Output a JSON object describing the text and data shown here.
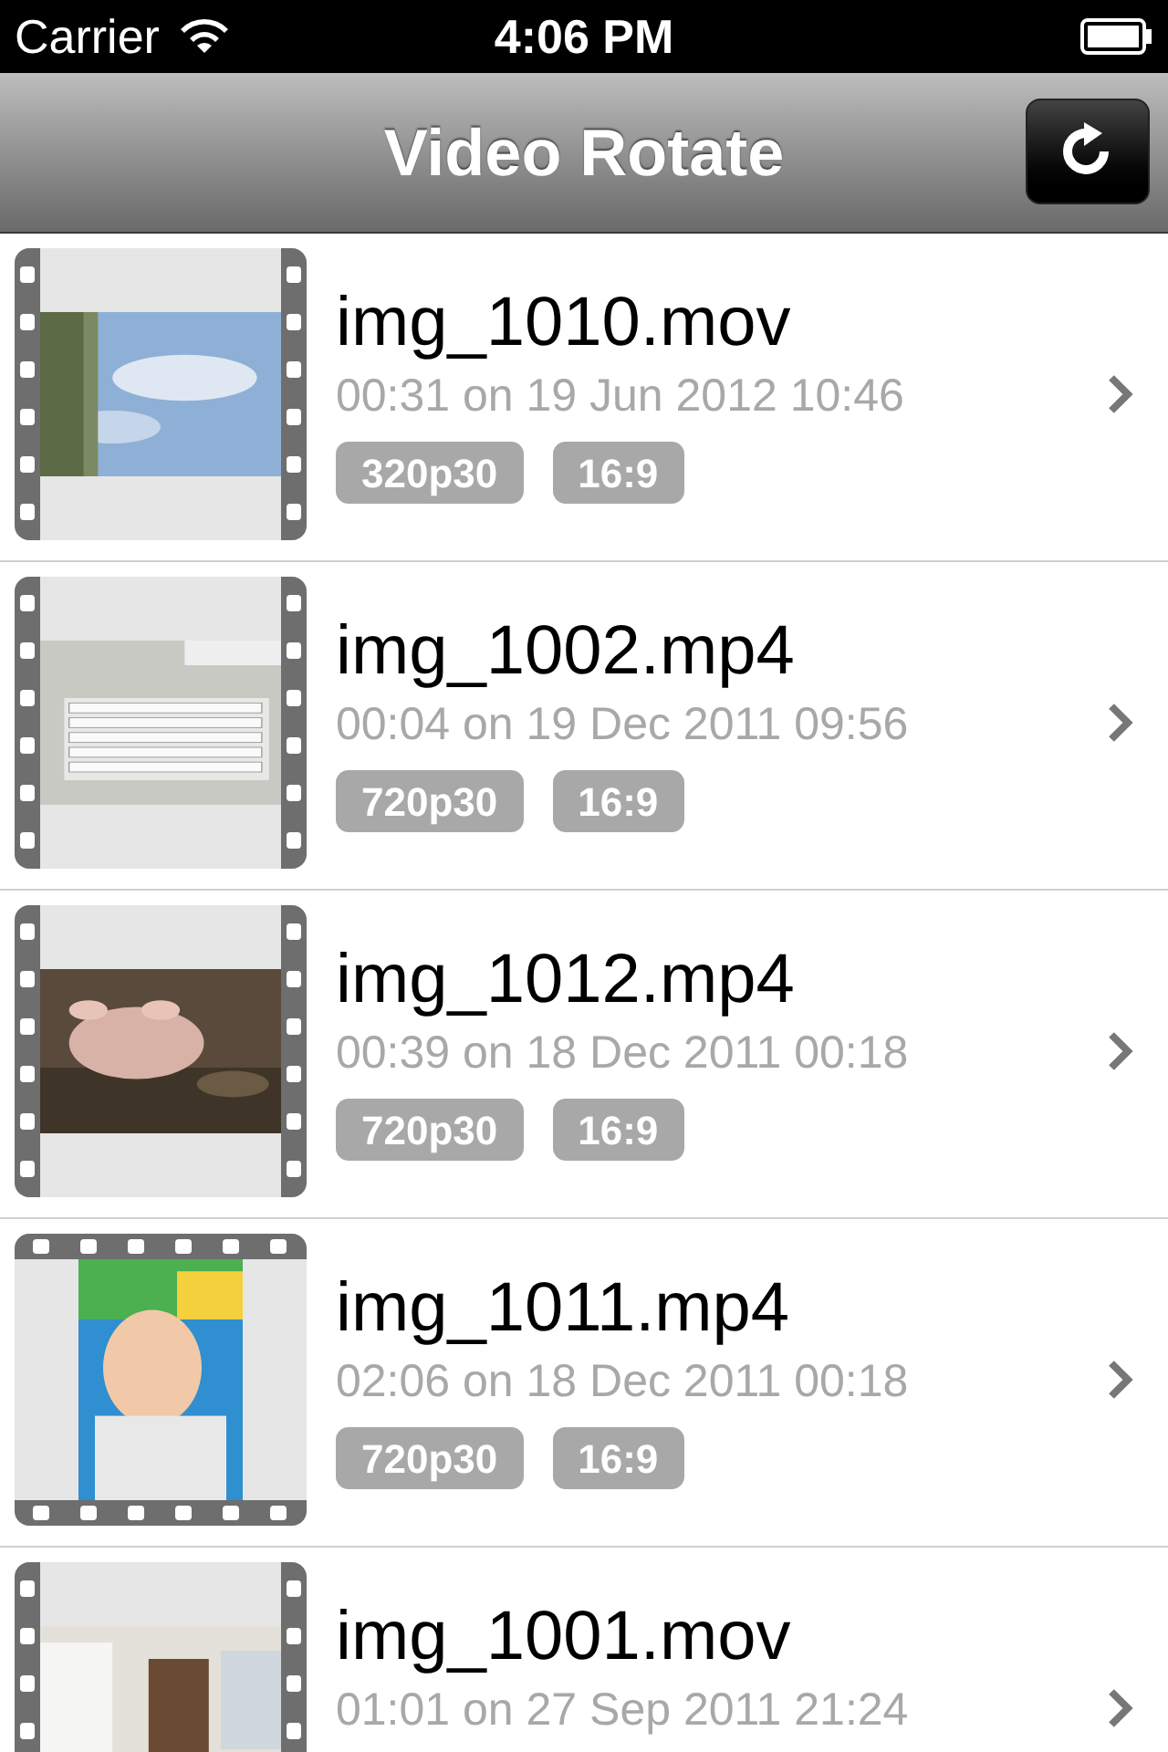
{
  "status_bar": {
    "carrier": "Carrier",
    "time": "4:06 PM"
  },
  "nav_bar": {
    "title": "Video Rotate"
  },
  "videos": [
    {
      "name": "img_1010.mov",
      "details": "00:31 on 19 Jun 2012 10:46",
      "tags": [
        "320p30",
        "16:9"
      ],
      "portrait": false
    },
    {
      "name": "img_1002.mp4",
      "details": "00:04 on 19 Dec 2011 09:56",
      "tags": [
        "720p30",
        "16:9"
      ],
      "portrait": false
    },
    {
      "name": "img_1012.mp4",
      "details": "00:39 on 18 Dec 2011 00:18",
      "tags": [
        "720p30",
        "16:9"
      ],
      "portrait": false
    },
    {
      "name": "img_1011.mp4",
      "details": "02:06 on 18 Dec 2011 00:18",
      "tags": [
        "720p30",
        "16:9"
      ],
      "portrait": true
    },
    {
      "name": "img_1001.mov",
      "details": "01:01 on 27 Sep 2011 21:24",
      "portrait": false
    }
  ]
}
